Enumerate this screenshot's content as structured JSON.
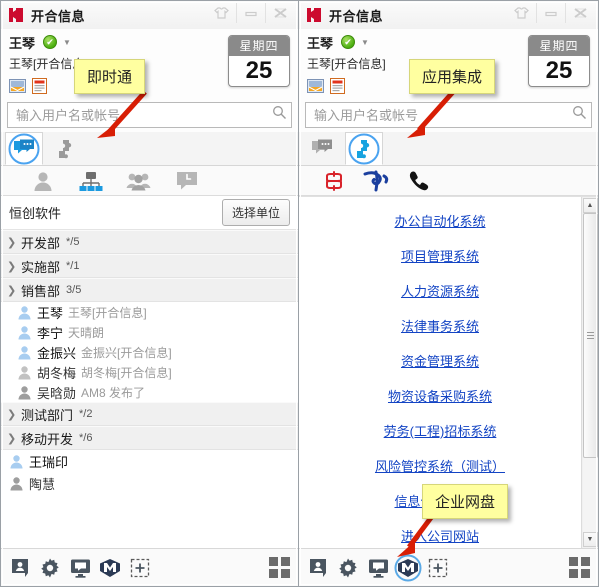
{
  "window": {
    "app_title": "开合信息",
    "logo_icon": "hk-logo-icon",
    "buttons": {
      "skin": "skin-icon",
      "minimize": "minimize-icon",
      "close": "close-icon"
    }
  },
  "profile": {
    "user_name": "王琴",
    "status_icon": "online-check-icon",
    "dropdown_icon": "chevron-down-icon",
    "signature": "王琴[开合信息]",
    "mini_icons": [
      "photo-mail-icon",
      "notes-icon"
    ]
  },
  "datecard": {
    "weekday": "星期四",
    "day": "25"
  },
  "search": {
    "placeholder": "输入用户名或帐号",
    "value": "",
    "icon": "search-icon"
  },
  "module_tabs": [
    {
      "name": "chat",
      "icon": "chat-bubble-icon",
      "active_left": true,
      "active_right": false
    },
    {
      "name": "apps",
      "icon": "puzzle-piece-icon",
      "active_left": false,
      "active_right": true
    }
  ],
  "left_panel": {
    "sub_tabs": [
      {
        "name": "contacts",
        "icon": "person-icon",
        "active": false
      },
      {
        "name": "org-chart",
        "icon": "org-chart-icon",
        "active": true
      },
      {
        "name": "groups",
        "icon": "group-icon",
        "active": false
      },
      {
        "name": "recent",
        "icon": "history-clock-icon",
        "active": false
      }
    ],
    "org_name": "恒创软件",
    "select_unit_label": "选择单位",
    "departments": [
      {
        "name": "开发部",
        "count": "*/5",
        "expanded": false,
        "members": []
      },
      {
        "name": "实施部",
        "count": "*/1",
        "expanded": false,
        "members": []
      },
      {
        "name": "销售部",
        "count": "3/5",
        "expanded": true,
        "members": [
          {
            "name": "王琴",
            "signature": "王琴[开合信息]",
            "online": true
          },
          {
            "name": "李宁",
            "signature": "天晴朗",
            "online": true
          },
          {
            "name": "金振兴",
            "signature": "金振兴[开合信息]",
            "online": true
          },
          {
            "name": "胡冬梅",
            "signature": "胡冬梅[开合信息]",
            "online": false
          },
          {
            "name": "吴晗勋",
            "signature": "AM8 发布了",
            "online": false
          }
        ]
      },
      {
        "name": "测试部门",
        "count": "*/2",
        "expanded": false,
        "members": []
      },
      {
        "name": "移动开发",
        "count": "*/6",
        "expanded": false,
        "members": []
      }
    ],
    "root_members": [
      {
        "name": "王瑞印",
        "online": true
      },
      {
        "name": "陶慧",
        "online": false
      }
    ]
  },
  "right_panel": {
    "sub_tabs": [
      {
        "name": "china-unicom",
        "icon": "china-unicom-logo-icon",
        "active": false
      },
      {
        "name": "china-telecom",
        "icon": "china-telecom-logo-icon",
        "active": false
      },
      {
        "name": "phone",
        "icon": "phone-handset-icon",
        "active": false
      }
    ],
    "app_links": [
      "办公自动化系统",
      "项目管理系统",
      "人力资源系统",
      "法律事务系统",
      "资金管理系统",
      "物资设备采购系统",
      "劳务(工程)招标系统",
      "风险管控系统（测试）",
      "信息化管理系统",
      "进入公司网站"
    ],
    "scrollbar": {
      "up_icon": "scroll-up-arrow-icon",
      "down_icon": "scroll-down-arrow-icon"
    }
  },
  "bottom_bar": {
    "icons": [
      {
        "name": "contact-card-icon",
        "highlighted_left": false,
        "highlighted_right": false
      },
      {
        "name": "gear-icon",
        "highlighted_left": false,
        "highlighted_right": false
      },
      {
        "name": "screen-chat-icon",
        "highlighted_left": false,
        "highlighted_right": false
      },
      {
        "name": "netdisk-m-icon",
        "highlighted_left": false,
        "highlighted_right": true
      },
      {
        "name": "add-plus-icon",
        "highlighted_left": false,
        "highlighted_right": false
      }
    ],
    "grid_icon": "grid-apps-icon"
  },
  "callouts": [
    {
      "text": "即时通",
      "panel": "left"
    },
    {
      "text": "应用集成",
      "panel": "right"
    },
    {
      "text": "企业网盘",
      "panel": "right"
    }
  ],
  "colors": {
    "accent_blue": "#1b9ae0",
    "link_blue": "#1344c4",
    "callout_yellow": "#ffffa0",
    "arrow_red": "#d81e05",
    "logo_red": "#cc0a2e",
    "online_green": "#4caf10"
  }
}
